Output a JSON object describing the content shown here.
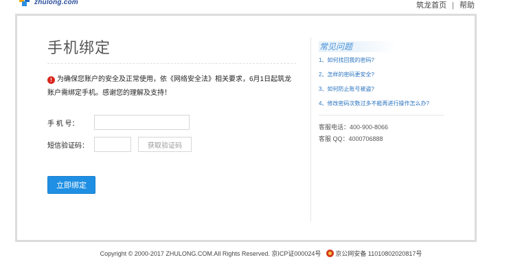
{
  "header": {
    "logo_text": "zhulong.com",
    "nav": [
      {
        "label": "筑龙首页"
      },
      {
        "label": "帮助"
      }
    ],
    "nav_separator": "|"
  },
  "main": {
    "title": "手机绑定",
    "notice_line1": "为确保您账户的安全及正常使用，依《网络安全法》相关要求，6月1日起筑龙",
    "notice_line2": "账户需绑定手机。感谢您的理解及支持！",
    "phone_label": "手 机 号：",
    "phone_value": "",
    "phone_placeholder": "",
    "code_label": "短信验证码：",
    "code_value": "",
    "code_placeholder": "",
    "get_code_label": "获取验证码",
    "submit_label": "立即绑定"
  },
  "faq": {
    "title": "常见问题",
    "items": [
      {
        "label": "1、如何找回我的密码?"
      },
      {
        "label": "2、怎样的密码更安全?"
      },
      {
        "label": "3、如何防止账号被盗?"
      },
      {
        "label": "4、修改密码次数过多不能再进行操作怎么办?"
      }
    ],
    "phone_line": "客服电话：400-900-8066",
    "qq_line": "客服 QQ：4000706888"
  },
  "footer": {
    "copyright": "Copyright © 2000-2017 ZHULONG.COM.All Rights Reserved. 京ICP证000024号",
    "police_record": "京公网安备 11010802020817号"
  },
  "colors": {
    "accent": "#1f8fe3",
    "link": "#2a73c0",
    "warning": "#d9251d",
    "frame_border": "#dcdcdc"
  },
  "icons": {
    "warning": "warning-icon",
    "logo": "zhulong-logo-icon",
    "police": "police-badge-icon"
  }
}
